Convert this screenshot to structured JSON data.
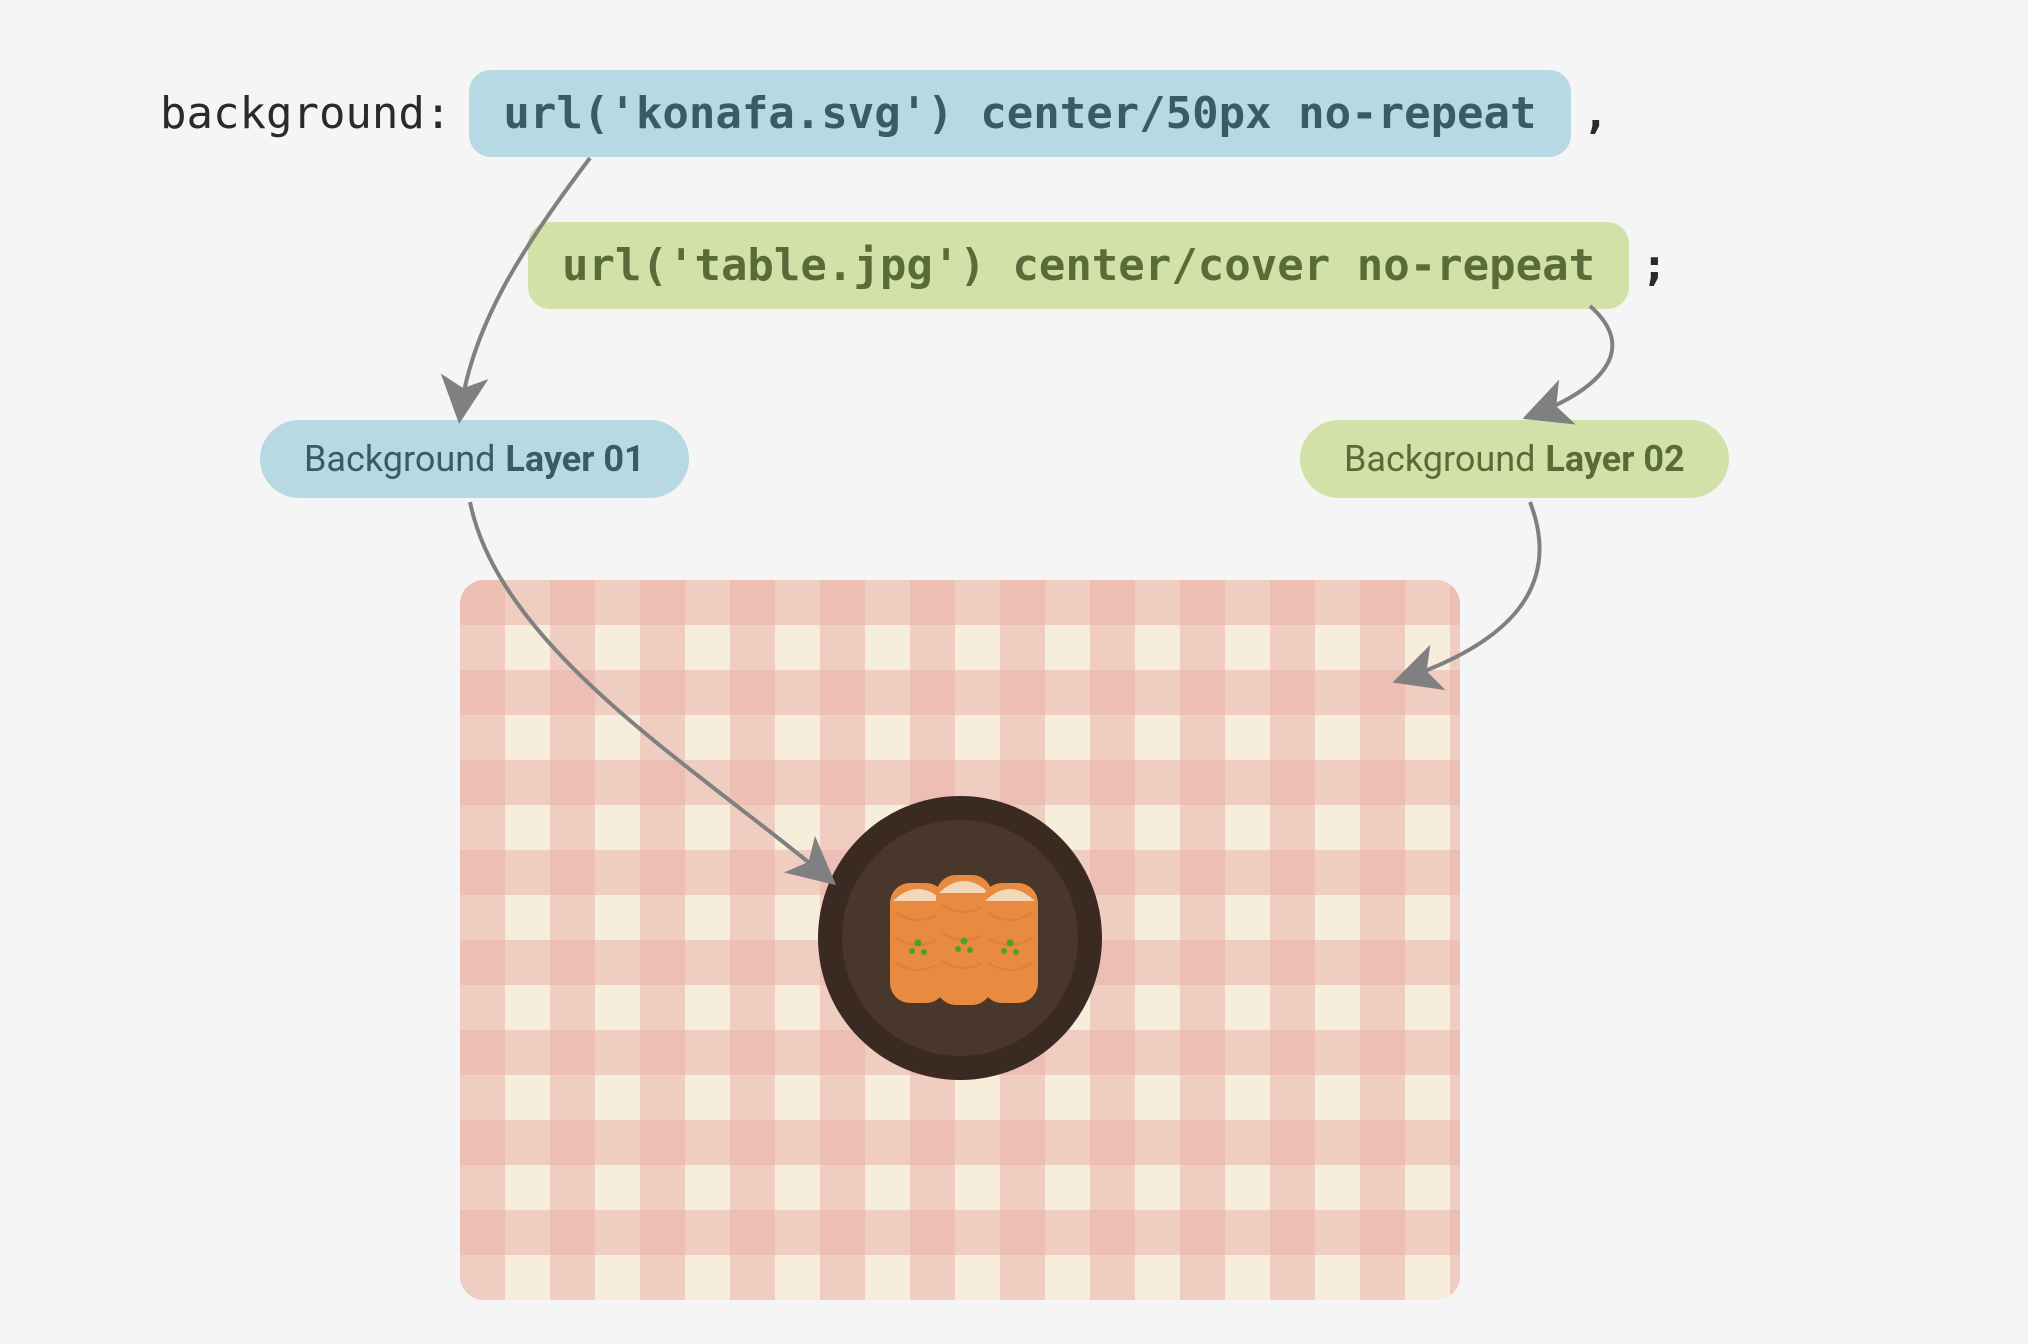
{
  "css_property": "background:",
  "layer1": {
    "code": "url('konafa.svg') center/50px no-repeat",
    "trailing": ",",
    "badge_prefix": "Background",
    "badge_bold": "Layer 01"
  },
  "layer2": {
    "code": "url('table.jpg') center/cover no-repeat",
    "trailing": ";",
    "badge_prefix": "Background",
    "badge_bold": "Layer 02"
  },
  "colors": {
    "blue_bg": "#b7d9e4",
    "green_bg": "#d2e1a8",
    "cloth_cream": "#f7eddb",
    "cloth_pink": "#e9b3a9",
    "plate_outer": "#3a2a21",
    "plate_inner": "#4a372b",
    "pastry": "#e88a3f",
    "pastry_top": "#f2d8b8",
    "garnish": "#4aa12f",
    "arrow": "#808080"
  }
}
